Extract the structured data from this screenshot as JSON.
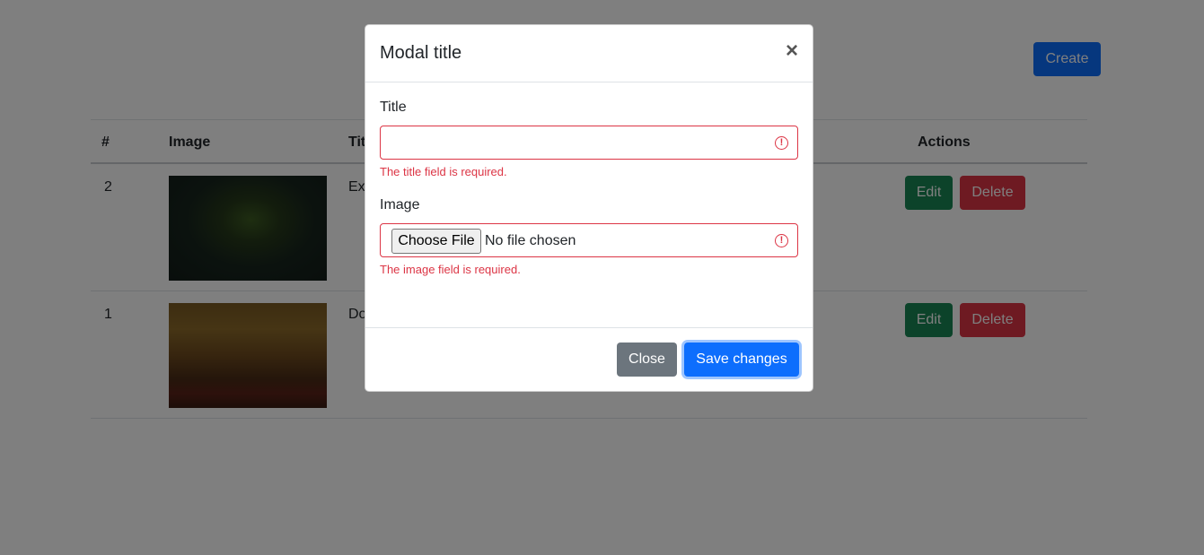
{
  "header": {
    "create_label": "Create"
  },
  "table": {
    "columns": {
      "num": "#",
      "image": "Image",
      "title": "Tit",
      "actions": "Actions"
    },
    "rows": [
      {
        "num": "2",
        "title": "Exc",
        "image_desc": "dark green forest foliage"
      },
      {
        "num": "1",
        "title": "Do",
        "image_desc": "autumn forest path"
      }
    ],
    "edit_label": "Edit",
    "delete_label": "Delete"
  },
  "modal": {
    "title": "Modal title",
    "close_icon": "×",
    "fields": {
      "title_label": "Title",
      "title_value": "",
      "title_error": "The title field is required.",
      "image_label": "Image",
      "choose_file_label": "Choose File",
      "no_file_text": "No file chosen",
      "image_error": "The image field is required.",
      "error_icon": "!"
    },
    "footer": {
      "close_label": "Close",
      "save_label": "Save changes"
    }
  },
  "colors": {
    "primary": "#0d6efd",
    "success": "#198754",
    "danger": "#dc3545",
    "secondary": "#6c757d"
  }
}
